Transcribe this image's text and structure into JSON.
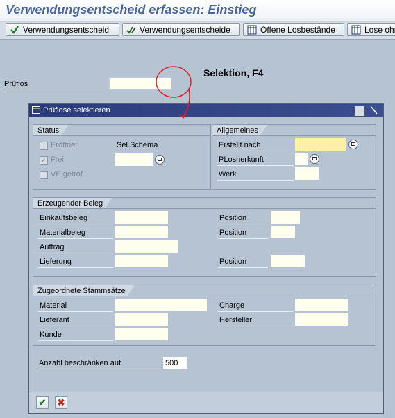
{
  "window": {
    "title": "Verwendungsentscheid erfassen: Einstieg"
  },
  "toolbar": {
    "btn1": "Verwendungsentscheid",
    "btn2": "Verwendungsentscheide",
    "btn3": "Offene Losbestände",
    "btn4": "Lose ohne"
  },
  "main": {
    "prueflos_label": "Prüflos",
    "prueflos_value": "",
    "annotation": "Selektion, F4"
  },
  "dialog": {
    "title": "Prüflose selektieren",
    "status": {
      "heading": "Status",
      "eroeffnet": "Eröffnet",
      "frei": "Frei",
      "ve_getrof": "VE getrof.",
      "sel_schema": "Sel.Schema",
      "sel_schema_value": ""
    },
    "allgemeines": {
      "heading": "Allgemeines",
      "erstellt_nach": "Erstellt nach",
      "erstellt_nach_value": "",
      "plosherkunft": "PLosherkunft",
      "plosherkunft_value": "",
      "werk": "Werk",
      "werk_value": ""
    },
    "erzeugender_beleg": {
      "heading": "Erzeugender Beleg",
      "einkaufsbeleg": "Einkaufsbeleg",
      "materialbeleg": "Materialbeleg",
      "auftrag": "Auftrag",
      "lieferung": "Lieferung",
      "position": "Position"
    },
    "stammsaetze": {
      "heading": "Zugeordnete Stammsätze",
      "material": "Material",
      "lieferant": "Lieferant",
      "kunde": "Kunde",
      "charge": "Charge",
      "hersteller": "Hersteller"
    },
    "anzahl": {
      "label": "Anzahl beschränken auf",
      "value": "500"
    },
    "footer": {
      "ok": "✔",
      "cancel": "✖"
    }
  },
  "colors": {
    "title": "#4a64a0",
    "dialog_title_bg": "#2a3b7a",
    "annotation": "#e02020"
  }
}
